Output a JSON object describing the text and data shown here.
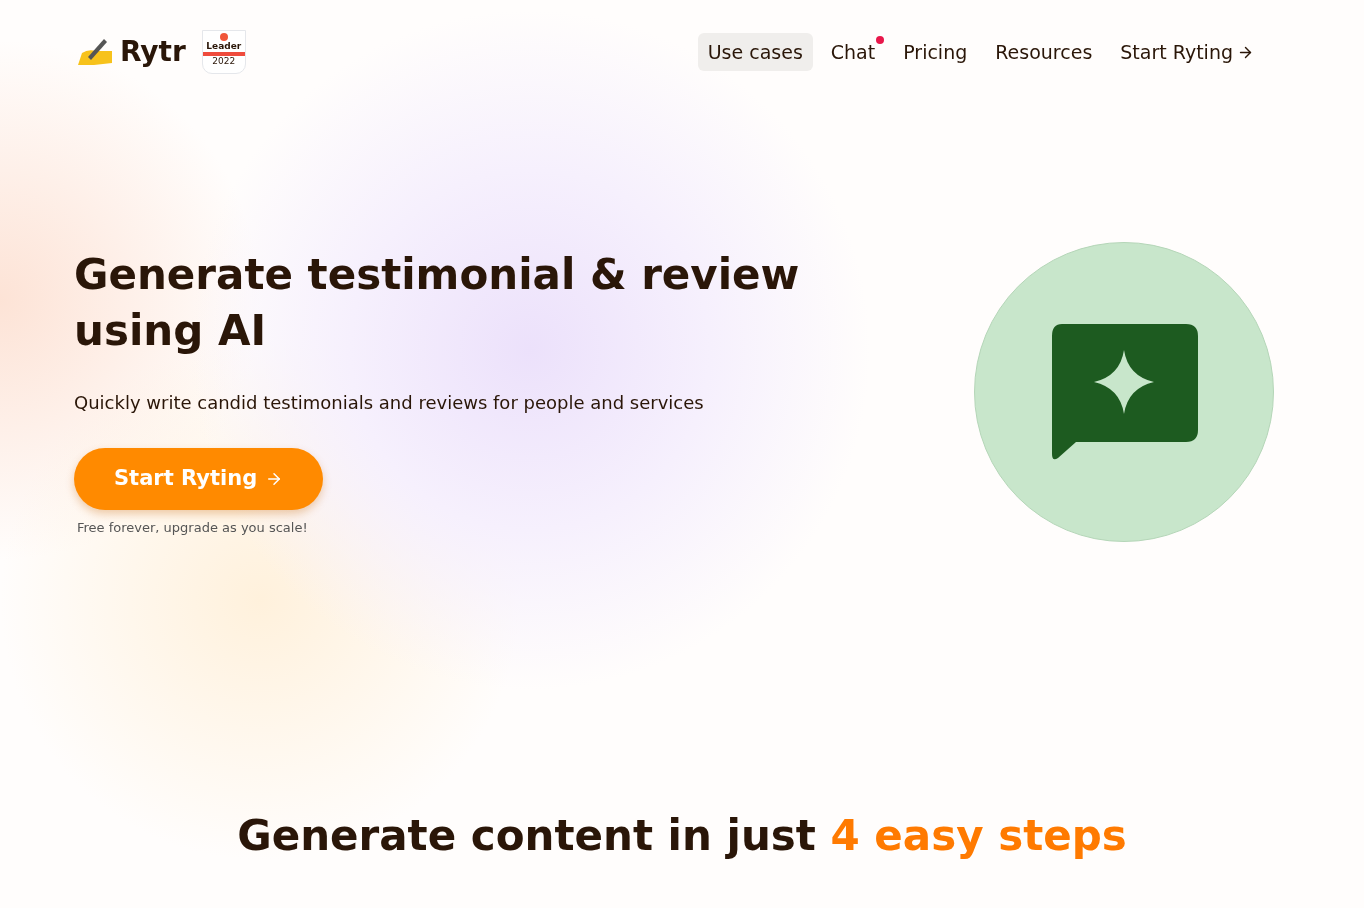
{
  "logo": {
    "name": "Rytr"
  },
  "badge": {
    "title": "Leader",
    "year": "2022"
  },
  "nav": [
    {
      "label": "Use cases",
      "selected": true,
      "dot": false
    },
    {
      "label": "Chat",
      "selected": false,
      "dot": true
    },
    {
      "label": "Pricing",
      "selected": false,
      "dot": false
    },
    {
      "label": "Resources",
      "selected": false,
      "dot": false
    },
    {
      "label": "Start Ryting",
      "selected": false,
      "dot": false
    }
  ],
  "hero": {
    "title": "Generate testimonial & review using AI",
    "subtitle": "Quickly write candid testimonials and reviews for people and services",
    "cta": "Start Ryting",
    "note": "Free forever, upgrade as you scale!"
  },
  "steps": {
    "text": "Generate content in just",
    "highlight": "4 easy steps"
  }
}
